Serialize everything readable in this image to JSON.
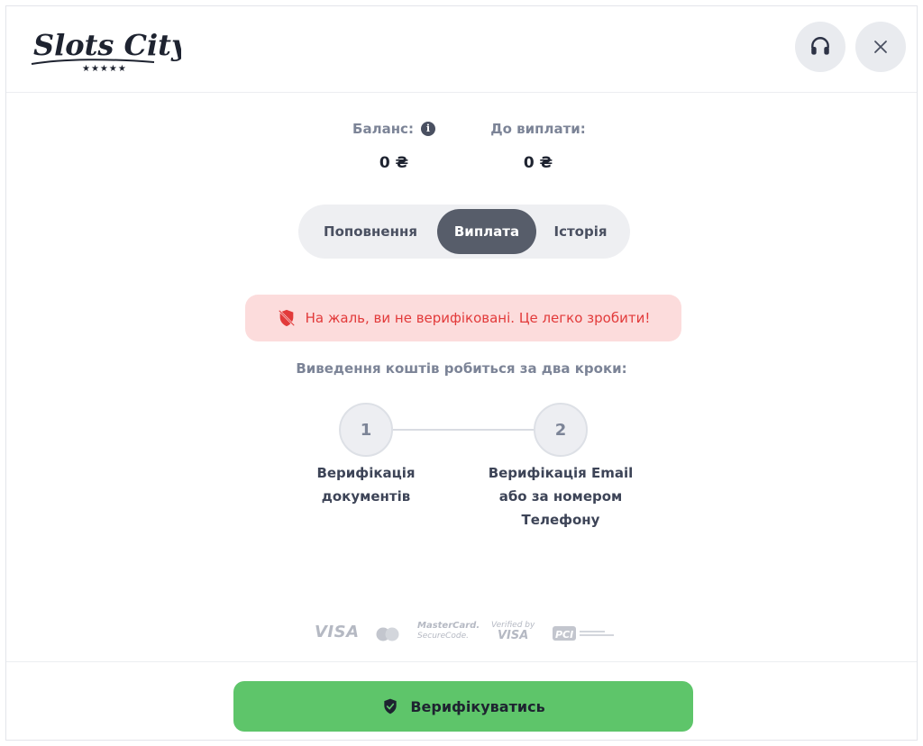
{
  "brand": {
    "logo_text": "Slots City",
    "stars": "★★★★★"
  },
  "header": {
    "support_icon": "headset-icon",
    "close_icon": "close-icon"
  },
  "balance": {
    "balance_label": "Баланс:",
    "balance_value": "0 ₴",
    "payout_label": "До виплати:",
    "payout_value": "0 ₴",
    "info_icon": "info-icon"
  },
  "tabs": [
    {
      "label": "Поповнення",
      "active": false
    },
    {
      "label": "Виплата",
      "active": true
    },
    {
      "label": "Історія",
      "active": false
    }
  ],
  "alert": {
    "icon": "shield-off-icon",
    "text": "На жаль, ви не верифіковані. Це легко зробити!",
    "color": "#e23a3a"
  },
  "steps": {
    "title": "Виведення коштів робиться за два кроки:",
    "items": [
      {
        "number": "1",
        "label_line1": "Верифікація",
        "label_line2": "документів",
        "label_line3": ""
      },
      {
        "number": "2",
        "label_line1": "Верифікація Email",
        "label_line2": "або за номером",
        "label_line3": "Телефону"
      }
    ]
  },
  "payment_logos": {
    "visa": "VISA",
    "mastercard_securecode_line1": "MasterCard.",
    "mastercard_securecode_line2": "SecureCode.",
    "verified_by_line1": "Verified by",
    "verified_by_line2": "VISA",
    "pci": "PCI"
  },
  "footer": {
    "verify_label": "Верифікуватись",
    "verify_icon": "shield-check-icon",
    "accent": "#5ec56a"
  }
}
